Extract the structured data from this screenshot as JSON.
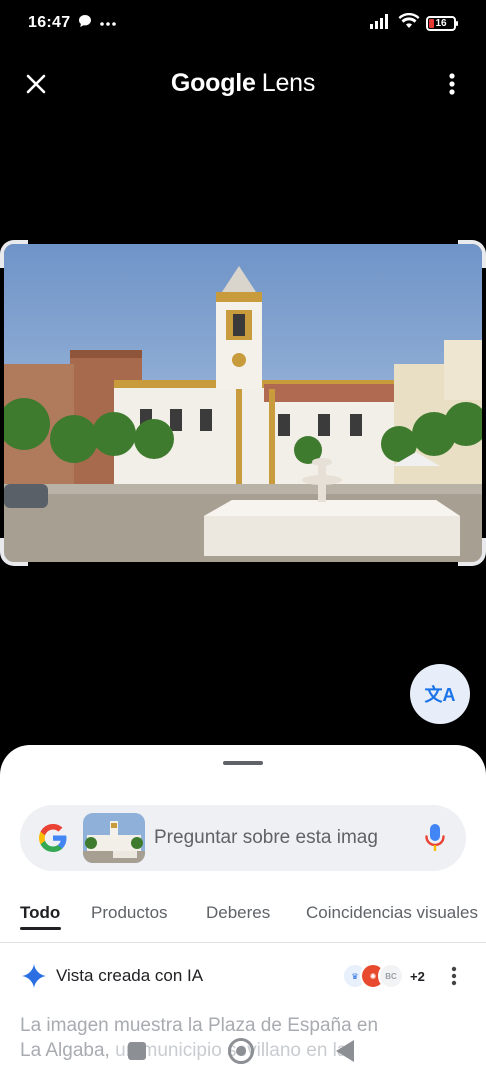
{
  "status_bar": {
    "time": "16:47",
    "battery_level": "16",
    "icons": [
      "chat-bubble-icon",
      "more-dots-icon",
      "signal-icon",
      "wifi-icon",
      "battery-icon"
    ]
  },
  "header": {
    "title_brand": "Google",
    "title_product": "Lens"
  },
  "translate_button": {
    "icon": "translate-icon",
    "glyph": "文A"
  },
  "search": {
    "placeholder": "Preguntar sobre esta imag"
  },
  "tabs": [
    {
      "label": "Todo",
      "active": true
    },
    {
      "label": "Productos",
      "active": false
    },
    {
      "label": "Deberes",
      "active": false
    },
    {
      "label": "Coincidencias visuales",
      "active": false
    }
  ],
  "ai_overview": {
    "label": "Vista creada con IA",
    "sources_more": "+2",
    "source_badge_text": "BC",
    "text_line1": "La imagen muestra la Plaza de España en",
    "text_line2a": "La Algaba, ",
    "text_line2b": "un municipio sevillano en la"
  },
  "colors": {
    "accent_blue": "#1a73e8",
    "sheet_bg": "#ffffff",
    "pill_bg": "#eef0f4"
  }
}
